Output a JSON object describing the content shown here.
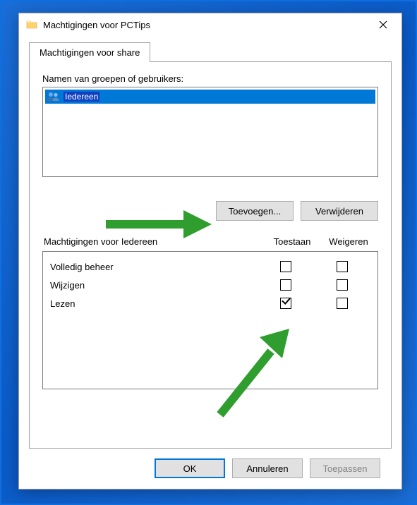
{
  "window": {
    "title": "Machtigingen voor PCTips"
  },
  "tab": {
    "label": "Machtigingen voor share"
  },
  "groups": {
    "label": "Namen van groepen of gebruikers:",
    "items": [
      {
        "name": "Iedereen",
        "selected": true
      }
    ]
  },
  "buttons": {
    "add": "Toevoegen...",
    "remove": "Verwijderen"
  },
  "permissions": {
    "header_label": "Machtigingen voor Iedereen",
    "col_allow": "Toestaan",
    "col_deny": "Weigeren",
    "rows": [
      {
        "name": "Volledig beheer",
        "allow": false,
        "deny": false
      },
      {
        "name": "Wijzigen",
        "allow": false,
        "deny": false
      },
      {
        "name": "Lezen",
        "allow": true,
        "deny": false
      }
    ]
  },
  "dialog": {
    "ok": "OK",
    "cancel": "Annuleren",
    "apply": "Toepassen"
  },
  "colors": {
    "selection": "#0078d7",
    "arrow": "#2f9e2f"
  }
}
